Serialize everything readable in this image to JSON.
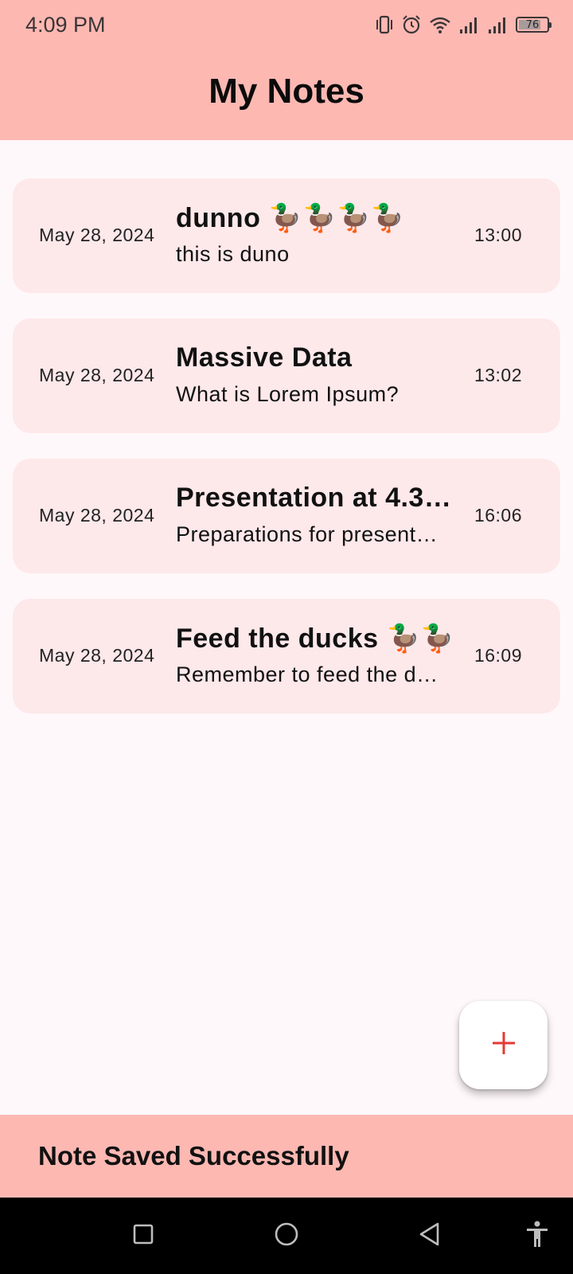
{
  "status_bar": {
    "time": "4:09 PM",
    "battery_level": "76",
    "icons": [
      "vibrate-icon",
      "alarm-icon",
      "wifi-icon",
      "signal-icon",
      "signal-icon",
      "battery-icon"
    ]
  },
  "app_bar": {
    "title": "My Notes"
  },
  "notes": [
    {
      "date": "May 28, 2024",
      "title": "dunno 🦆🦆🦆🦆",
      "body": "this is duno",
      "time": "13:00"
    },
    {
      "date": "May 28, 2024",
      "title": "Massive Data",
      "body": "What is Lorem Ipsum?",
      "time": "13:02"
    },
    {
      "date": "May 28, 2024",
      "title": "Presentation at 4.3…",
      "body": "Preparations for present…",
      "time": "16:06"
    },
    {
      "date": "May 28, 2024",
      "title": "Feed the ducks 🦆🦆",
      "body": "Remember to feed the d…",
      "time": "16:09"
    }
  ],
  "fab": {
    "icon": "plus-icon",
    "color": "#e53935"
  },
  "snackbar": {
    "message": "Note Saved Successfully"
  },
  "nav_bar": {
    "buttons": [
      "recents-icon",
      "home-icon",
      "back-icon",
      "accessibility-icon"
    ]
  },
  "colors": {
    "app_bar": "#fdb8b2",
    "card": "#fde8ea",
    "background": "#fff8fb",
    "accent": "#e53935"
  }
}
